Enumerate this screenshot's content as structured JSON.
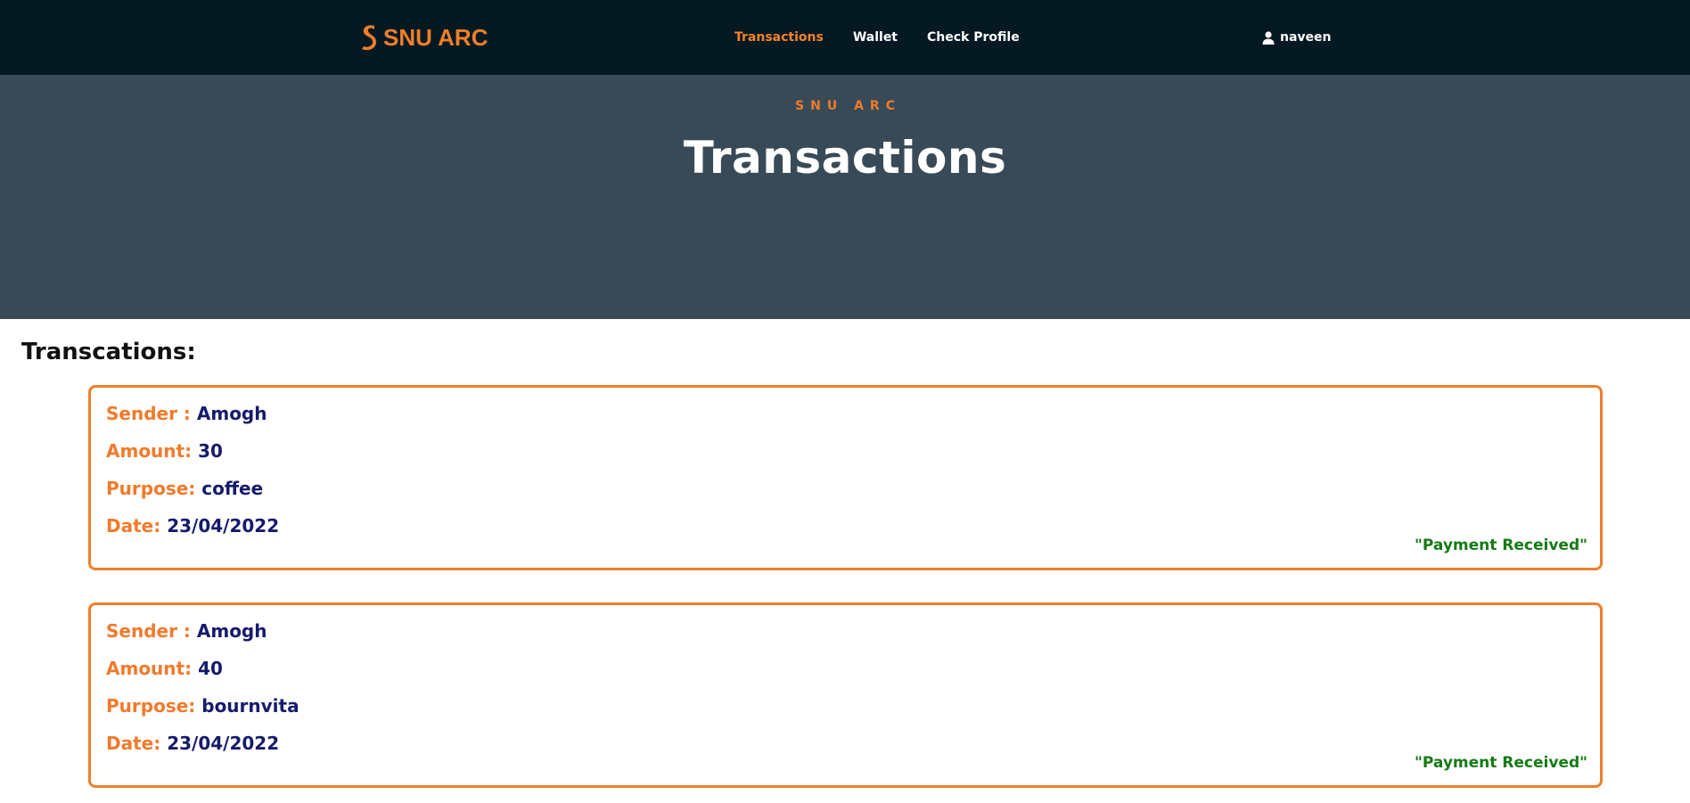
{
  "brand": {
    "name": "SNU ARC",
    "icon": "s-logo-icon",
    "color": "#ef7f2a"
  },
  "nav": {
    "links": [
      {
        "label": "Transactions",
        "active": true
      },
      {
        "label": "Wallet",
        "active": false
      },
      {
        "label": "Check Profile",
        "active": false
      }
    ],
    "user": {
      "icon": "user-icon",
      "name": "naveen"
    }
  },
  "hero": {
    "eyebrow": "SNU ARC",
    "title": "Transactions"
  },
  "main": {
    "section_title": "Transcations:",
    "labels": {
      "sender": "Sender :",
      "amount": "Amount:",
      "purpose": "Purpose:",
      "date": "Date:"
    },
    "transactions": [
      {
        "sender": "Amogh",
        "amount": "30",
        "purpose": "coffee",
        "date": "23/04/2022",
        "status": "\"Payment Received\""
      },
      {
        "sender": "Amogh",
        "amount": "40",
        "purpose": "bournvita",
        "date": "23/04/2022",
        "status": "\"Payment Received\""
      }
    ]
  },
  "colors": {
    "navbar_bg": "#051923",
    "hero_bg": "#384a57",
    "accent": "#ef7f2a",
    "value_text": "#151b6b",
    "status_green": "#147a14"
  }
}
